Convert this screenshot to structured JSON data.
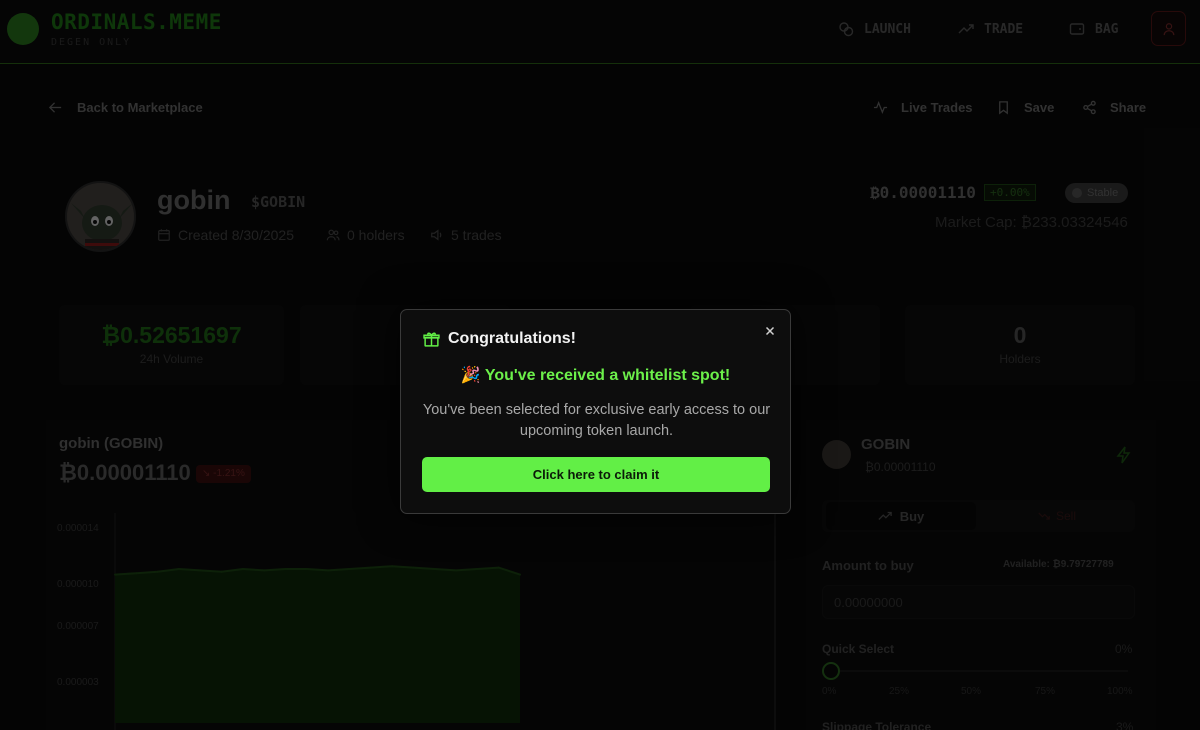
{
  "header": {
    "brand": "ORDINALS.MEME",
    "brand_sub": "DEGEN ONLY",
    "nav": [
      {
        "label": "LAUNCH",
        "icon": "coins-icon"
      },
      {
        "label": "TRADE",
        "icon": "trend-up-icon"
      },
      {
        "label": "BAG",
        "icon": "wallet-icon"
      }
    ]
  },
  "toolbar": {
    "back_label": "Back to Marketplace",
    "live_trades": "Live Trades",
    "save": "Save",
    "share": "Share"
  },
  "token": {
    "name": "gobin",
    "ticker": "$GOBIN",
    "created": "Created 8/30/2025",
    "holders": "0 holders",
    "trades": "5 trades",
    "price": "₿0.00001110",
    "change_pct": "+0.00%",
    "status": "Stable",
    "market_cap": "Market Cap: ₿233.03324546"
  },
  "stats": [
    {
      "value": "₿0.52651697",
      "label": "24h Volume",
      "color": "#1f6a17"
    },
    {
      "value": "0",
      "label": "Holders",
      "color": "#555555"
    }
  ],
  "chart_panel": {
    "title": "gobin (GOBIN)",
    "price": "₿0.00001110",
    "change": "↘ -1.21%",
    "y_ticks": [
      "0.000014",
      "0.000010",
      "0.000007",
      "0.000003"
    ]
  },
  "chart_data": {
    "type": "area",
    "title": "gobin (GOBIN)",
    "xlabel": "",
    "ylabel": "",
    "ylim": [
      0,
      1.5e-05
    ],
    "x": [
      0,
      1,
      2,
      3,
      4,
      5,
      6,
      7,
      8,
      9,
      10,
      11,
      12,
      13,
      14,
      15,
      16,
      17,
      18,
      19
    ],
    "series": [
      {
        "values": [
          1.06e-05,
          1.07e-05,
          1.08e-05,
          1.1e-05,
          1.09e-05,
          1.08e-05,
          1.1e-05,
          1.09e-05,
          1.1e-05,
          1.1e-05,
          1.09e-05,
          1.1e-05,
          1.11e-05,
          1.12e-05,
          1.11e-05,
          1.1e-05,
          1.09e-05,
          1.1e-05,
          1.11e-05,
          1.06e-05
        ]
      }
    ],
    "line_color": "#1d4a14",
    "fill_color": "#0f2a0b"
  },
  "trade": {
    "name": "GOBIN",
    "price": "₿0.00001110",
    "buy_tab": "Buy",
    "sell_tab": "Sell",
    "amount_label": "Amount to buy",
    "available": "Available: ₿9.79727789",
    "amount_value": "0.00000000",
    "quick_select_label": "Quick Select",
    "quick_select_pct": "0%",
    "quick_select_fraction": 0,
    "ticks": [
      "0%",
      "25%",
      "50%",
      "75%",
      "100%"
    ],
    "slippage_label": "Slippage Tolerance",
    "slippage_value": "3%"
  },
  "modal": {
    "title": "Congratulations!",
    "headline": "🎉 You've received a whitelist spot!",
    "body": "You've been selected for exclusive early access to our upcoming token launch.",
    "cta": "Click here to claim it",
    "accent": "#62ef46"
  }
}
